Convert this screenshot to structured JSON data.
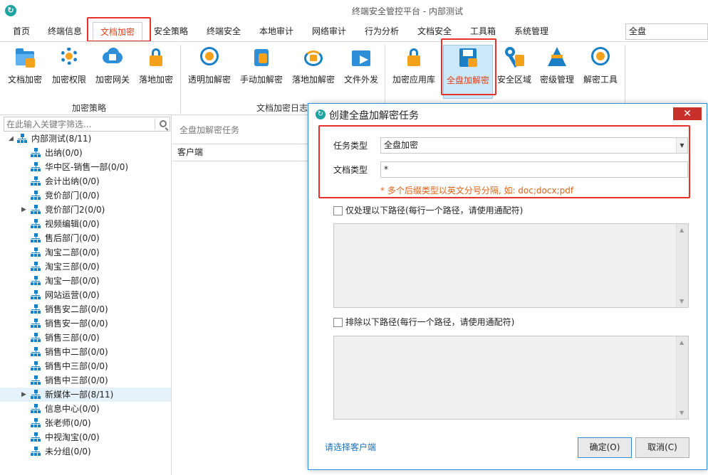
{
  "app": {
    "title": "终端安全管控平台 - 内部测试",
    "logo_glyph": "↻"
  },
  "menu": {
    "items": [
      "首页",
      "终端信息",
      "文档加密",
      "安全策略",
      "终端安全",
      "本地审计",
      "网络审计",
      "行为分析",
      "文档安全",
      "工具箱",
      "系统管理"
    ],
    "active": "文档加密",
    "scope_value": "全盘"
  },
  "ribbon": {
    "groups": [
      {
        "label": "加密策略",
        "buttons": [
          {
            "label": "文档加密",
            "icon": "folder-lock-icon"
          },
          {
            "label": "加密权限",
            "icon": "gear-lock-icon"
          },
          {
            "label": "加密网关",
            "icon": "cloud-lock-icon"
          },
          {
            "label": "落地加密",
            "icon": "lock-icon"
          }
        ]
      },
      {
        "label": "文档加密日志",
        "buttons": [
          {
            "label": "透明加解密",
            "icon": "target-lock-icon"
          },
          {
            "label": "手动加解密",
            "icon": "hand-lock-icon"
          },
          {
            "label": "落地加解密",
            "icon": "sync-lock-icon"
          },
          {
            "label": "文件外发",
            "icon": "folder-share-icon"
          }
        ]
      },
      {
        "label": "",
        "buttons": [
          {
            "label": "加密应用库",
            "icon": "lock-icon"
          },
          {
            "label": "全盘加解密",
            "icon": "disk-lock-icon"
          },
          {
            "label": "安全区域",
            "icon": "key-icon"
          },
          {
            "label": "密级管理",
            "icon": "pyramid-icon"
          },
          {
            "label": "解密工具",
            "icon": "target-lock-icon"
          }
        ]
      }
    ],
    "active": "全盘加解密"
  },
  "sidebar": {
    "search_placeholder": "在此输入关键字筛选...",
    "root": "内部测试(8/11)",
    "items": [
      {
        "label": "出纳(0/0)",
        "expandable": false,
        "selected": false
      },
      {
        "label": "华中区-销售一部(0/0)",
        "expandable": false,
        "selected": false
      },
      {
        "label": "会计出纳(0/0)",
        "expandable": false,
        "selected": false
      },
      {
        "label": "竞价部门(0/0)",
        "expandable": false,
        "selected": false
      },
      {
        "label": "竞价部门2(0/0)",
        "expandable": true,
        "selected": false
      },
      {
        "label": "视频编辑(0/0)",
        "expandable": false,
        "selected": false
      },
      {
        "label": "售后部门(0/0)",
        "expandable": false,
        "selected": false
      },
      {
        "label": "淘宝二部(0/0)",
        "expandable": false,
        "selected": false
      },
      {
        "label": "淘宝三部(0/0)",
        "expandable": false,
        "selected": false
      },
      {
        "label": "淘宝一部(0/0)",
        "expandable": false,
        "selected": false
      },
      {
        "label": "网站运营(0/0)",
        "expandable": false,
        "selected": false
      },
      {
        "label": "销售安二部(0/0)",
        "expandable": false,
        "selected": false
      },
      {
        "label": "销售安一部(0/0)",
        "expandable": false,
        "selected": false
      },
      {
        "label": "销售三部(0/0)",
        "expandable": false,
        "selected": false
      },
      {
        "label": "销售中二部(0/0)",
        "expandable": false,
        "selected": false
      },
      {
        "label": "销售中三部(0/0)",
        "expandable": false,
        "selected": false
      },
      {
        "label": "销售中三部(0/0)",
        "expandable": false,
        "selected": false
      },
      {
        "label": "新媒体一部(8/11)",
        "expandable": true,
        "selected": true
      },
      {
        "label": "信息中心(0/0)",
        "expandable": false,
        "selected": false
      },
      {
        "label": "张老师(0/0)",
        "expandable": false,
        "selected": false
      },
      {
        "label": "中视淘宝(0/0)",
        "expandable": false,
        "selected": false
      },
      {
        "label": "未分组(0/0)",
        "expandable": false,
        "selected": false
      }
    ]
  },
  "main": {
    "title": "全盘加解密任务",
    "column": "客户端"
  },
  "dialog": {
    "title": "创建全盘加解密任务",
    "close_glyph": "✕",
    "task_type_label": "任务类型",
    "task_type_value": "全盘加密",
    "doc_type_label": "文档类型",
    "doc_type_value": "*",
    "hint": "* 多个后缀类型以英文分号分隔, 如: doc;docx;pdf",
    "include_label": "仅处理以下路径(每行一个路径，请使用通配符)",
    "exclude_label": "排除以下路径(每行一个路径，请使用通配符)",
    "client_link": "请选择客户端",
    "ok": "确定(O)",
    "cancel": "取消(C)"
  }
}
